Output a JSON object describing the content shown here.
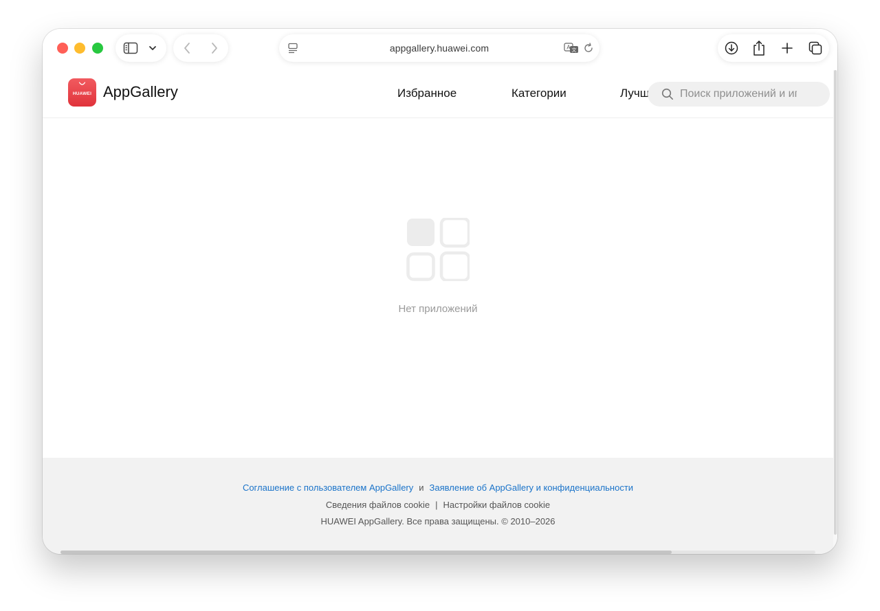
{
  "browser": {
    "url": "appgallery.huawei.com",
    "icons": {
      "sidebar": "sidebar-icon",
      "dropdown": "chevron-down-icon",
      "back": "chevron-left-icon",
      "forward": "chevron-right-icon",
      "page_menu": "page-menu-icon",
      "translate": "translate-icon",
      "reload": "reload-icon",
      "download": "download-icon",
      "share": "share-icon",
      "new_tab": "plus-icon",
      "tabs": "tab-overview-icon"
    }
  },
  "header": {
    "logo_text": "HUAWEI",
    "brand": "AppGallery",
    "nav": [
      "Избранное",
      "Категории",
      "Лучшие"
    ],
    "search_placeholder": "Поиск приложений и игр",
    "colors": {
      "logo": "#e5393f"
    }
  },
  "main": {
    "empty_message": "Нет приложений",
    "empty_icon": "app-grid-icon"
  },
  "footer": {
    "user_agreement": "Соглашение с пользователем AppGallery",
    "and": "и",
    "privacy_statement": "Заявление об AppGallery и конфиденциальности",
    "cookie_info": "Сведения файлов cookie",
    "divider": "|",
    "cookie_settings": "Настройки файлов cookie",
    "copyright": "HUAWEI AppGallery. Все права защищены. © 2010–2026",
    "colors": {
      "link": "#1a73c9"
    }
  },
  "scroll": {
    "horizontal_thumb_fraction": 0.81
  }
}
